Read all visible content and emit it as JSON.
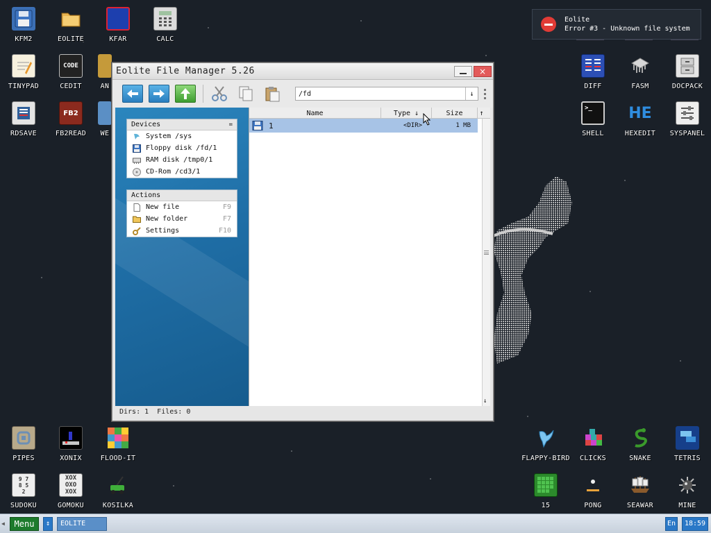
{
  "desktop": {
    "icons_left": [
      {
        "label": "KFM2",
        "icon": "floppy-icon"
      },
      {
        "label": "EOLITE",
        "icon": "folder-icon"
      },
      {
        "label": "KFAR",
        "icon": "kfar-icon"
      },
      {
        "label": "CALC",
        "icon": "calculator-icon"
      },
      {
        "label": "TINYPAD",
        "icon": "notepad-icon"
      },
      {
        "label": "CEDIT",
        "icon": "code-editor-icon"
      },
      {
        "label": "AN",
        "icon": "animation-icon"
      },
      {
        "label": "RDSAVE",
        "icon": "ramdisk-save-icon"
      },
      {
        "label": "FB2READ",
        "icon": "book-reader-icon"
      },
      {
        "label": "WE",
        "icon": "web-icon"
      },
      {
        "label": "PIPES",
        "icon": "pipes-icon"
      },
      {
        "label": "XONIX",
        "icon": "xonix-icon"
      },
      {
        "label": "FLOOD-IT",
        "icon": "flood-it-icon"
      },
      {
        "label": "SUDOKU",
        "icon": "sudoku-icon"
      },
      {
        "label": "GOMOKU",
        "icon": "gomoku-icon"
      },
      {
        "label": "KOSILKA",
        "icon": "lawnmower-icon"
      }
    ],
    "icons_right": [
      {
        "label": "DIFF",
        "icon": "diff-icon"
      },
      {
        "label": "FASM",
        "icon": "fasm-icon"
      },
      {
        "label": "DOCPACK",
        "icon": "docpack-icon"
      },
      {
        "label": "SHELL",
        "icon": "shell-icon"
      },
      {
        "label": "HEXEDIT",
        "icon": "hex-editor-icon"
      },
      {
        "label": "SYSPANEL",
        "icon": "sliders-icon"
      },
      {
        "label": "FLAPPY-BIRD",
        "icon": "bird-icon"
      },
      {
        "label": "CLICKS",
        "icon": "clicks-icon"
      },
      {
        "label": "SNAKE",
        "icon": "snake-icon"
      },
      {
        "label": "TETRIS",
        "icon": "tetris-icon"
      },
      {
        "label": "15",
        "icon": "fifteen-puzzle-icon"
      },
      {
        "label": "PONG",
        "icon": "pong-icon"
      },
      {
        "label": "SEAWAR",
        "icon": "ship-icon"
      },
      {
        "label": "MINE",
        "icon": "mine-icon"
      }
    ]
  },
  "notification": {
    "title": "Eolite",
    "message": "Error #3 - Unknown file system",
    "icon": "error-stop-icon",
    "color": "#e13b36"
  },
  "window": {
    "title": "Eolite File Manager 5.26",
    "toolbar": {
      "icons": [
        "back-arrow-icon",
        "forward-arrow-icon",
        "up-arrow-icon",
        "cut-icon",
        "copy-icon",
        "paste-icon"
      ],
      "address_value": "/fd",
      "address_dropdown": "↓"
    },
    "devices": {
      "header": "Devices",
      "header_menu": "=",
      "items": [
        {
          "label": "System /sys",
          "icon": "system-icon"
        },
        {
          "label": "Floppy disk /fd/1",
          "icon": "floppy-icon"
        },
        {
          "label": "RAM disk /tmp0/1",
          "icon": "ram-icon"
        },
        {
          "label": "CD-Rom /cd3/1",
          "icon": "cd-icon"
        }
      ]
    },
    "actions": {
      "header": "Actions",
      "items": [
        {
          "label": "New file",
          "key": "F9",
          "icon": "new-file-icon"
        },
        {
          "label": "New folder",
          "key": "F7",
          "icon": "new-folder-icon"
        },
        {
          "label": "Settings",
          "key": "F10",
          "icon": "settings-icon"
        }
      ]
    },
    "columns": {
      "name": "Name",
      "type": "Type",
      "type_sort": "↓",
      "size": "Size",
      "scroll_up": "↑",
      "scroll_down": "↓"
    },
    "files": [
      {
        "name": "1",
        "type": "<DIR>",
        "size": "1 MB",
        "icon": "floppy-icon",
        "selected": true
      }
    ],
    "status": "Dirs: 1  Files: 0"
  },
  "taskbar": {
    "menu_label": "Menu",
    "switch_label": "↕",
    "task_item": "EOLITE",
    "lang": "En",
    "clock": "18:59"
  },
  "colors": {
    "accent": "#2a78c7",
    "menu_green": "#1d7b2c",
    "selection": "#a7c3e6"
  }
}
